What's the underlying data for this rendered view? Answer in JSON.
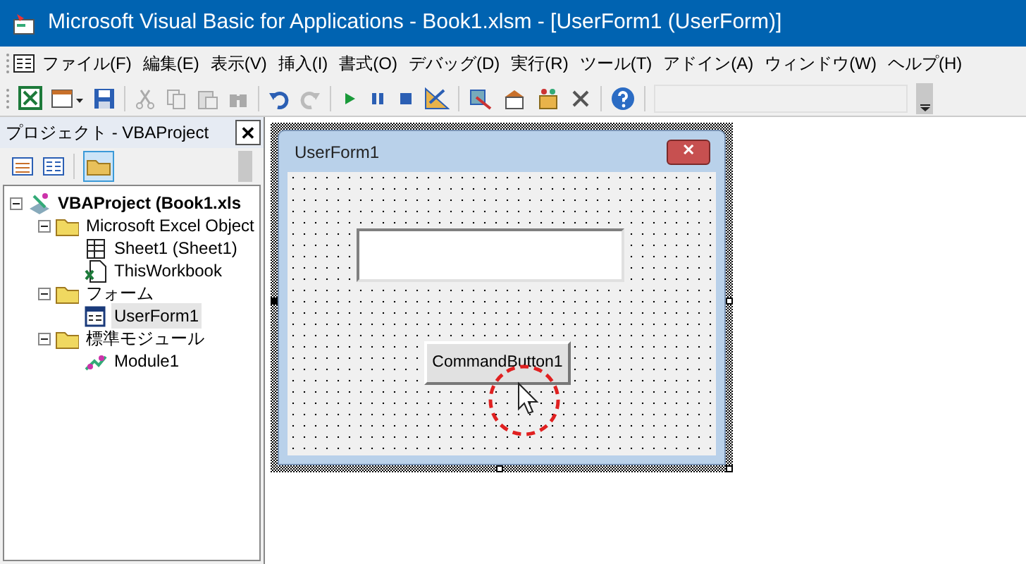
{
  "window": {
    "title": "Microsoft Visual Basic for Applications - Book1.xlsm - [UserForm1 (UserForm)]"
  },
  "menu": [
    "ファイル(F)",
    "編集(E)",
    "表示(V)",
    "挿入(I)",
    "書式(O)",
    "デバッグ(D)",
    "実行(R)",
    "ツール(T)",
    "アドイン(A)",
    "ウィンドウ(W)",
    "ヘルプ(H)"
  ],
  "project_panel": {
    "title": "プロジェクト - VBAProject",
    "close": "✕",
    "tree": [
      {
        "label": "VBAProject (Book1.xls",
        "kind": "project",
        "expanded": true,
        "selected": false,
        "children": [
          {
            "label": "Microsoft Excel Object",
            "kind": "folder",
            "expanded": true,
            "selected": false,
            "children": [
              {
                "label": "Sheet1 (Sheet1)",
                "kind": "sheet",
                "selected": false
              },
              {
                "label": "ThisWorkbook",
                "kind": "workbook",
                "selected": false
              }
            ]
          },
          {
            "label": "フォーム",
            "kind": "folder",
            "expanded": true,
            "selected": false,
            "children": [
              {
                "label": "UserForm1",
                "kind": "form",
                "selected": true
              }
            ]
          },
          {
            "label": "標準モジュール",
            "kind": "folder",
            "expanded": true,
            "selected": false,
            "children": [
              {
                "label": "Module1",
                "kind": "module",
                "selected": false
              }
            ]
          }
        ]
      }
    ]
  },
  "form": {
    "title": "UserForm1",
    "close": "✕",
    "controls": [
      {
        "kind": "textbox"
      },
      {
        "kind": "button",
        "label": "CommandButton1"
      }
    ]
  }
}
